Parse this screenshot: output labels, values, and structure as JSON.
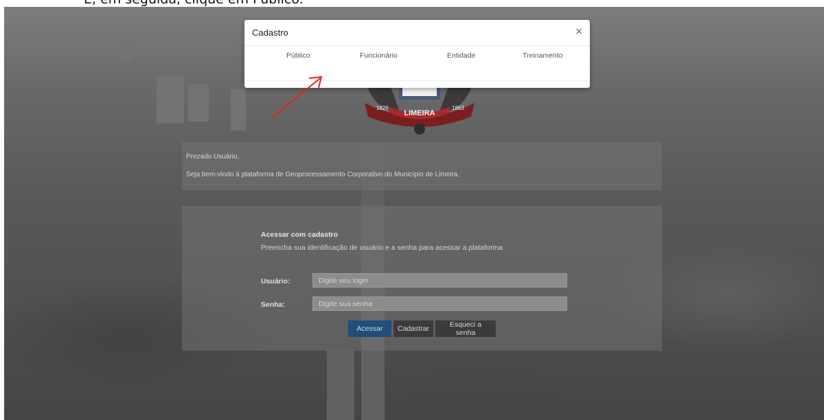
{
  "instruction": "E, em seguida, clique em Público.",
  "modal": {
    "title": "Cadastro",
    "close": "×",
    "tabs": [
      {
        "label": "Público"
      },
      {
        "label": "Funcionário"
      },
      {
        "label": "Entidade"
      },
      {
        "label": "Treinamento"
      }
    ]
  },
  "crest": {
    "ribbon_text": "LIMEIRA",
    "year_left": "1826",
    "year_right": "1863"
  },
  "welcome": {
    "greeting": "Prezado Usuário,",
    "message": "Seja bem-vindo à plataforma de Geoprocessamento Corporativo do Município de Limeira."
  },
  "login": {
    "title": "Acessar com cadastro",
    "subtitle": "Preencha sua identificação de usuário e a senha para acessar a plataforma",
    "user_label": "Usuário:",
    "user_placeholder": "Digite seu login",
    "password_label": "Senha:",
    "password_placeholder": "Digite sua senha",
    "access_button": "Acessar",
    "register_button": "Cadastrar",
    "forgot_button": "Esqueci a senha"
  },
  "colors": {
    "arrow": "#e82020",
    "primary_button": "#1f4f7a"
  }
}
